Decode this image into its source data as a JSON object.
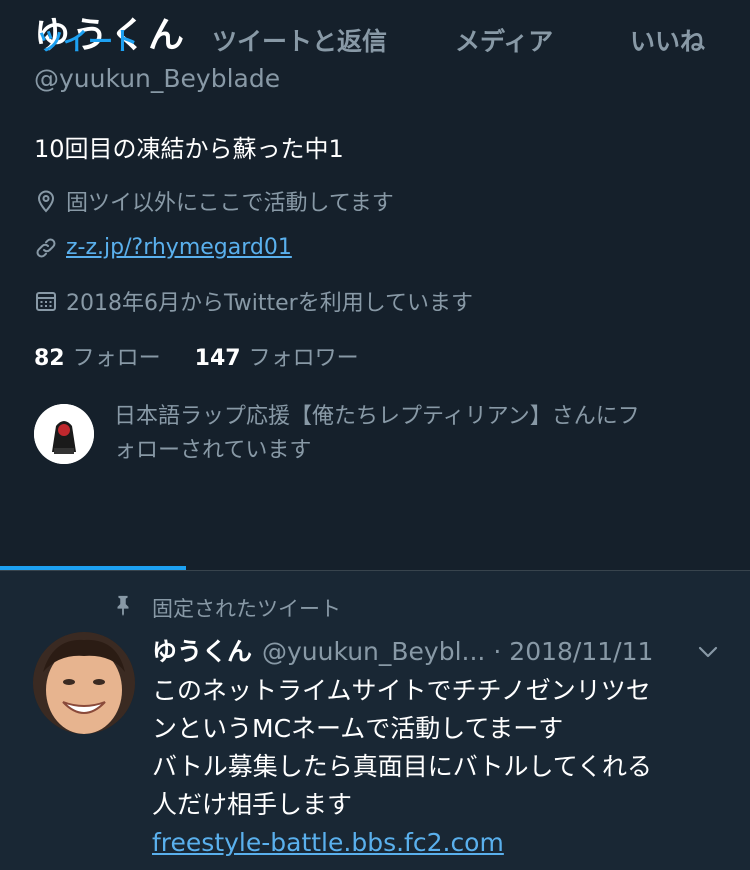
{
  "profile": {
    "name": "ゆうくん",
    "handle": "@yuukun_Beyblade",
    "bio": "10回目の凍結から蘇った中1",
    "location": "固ツイ以外にここで活動してます",
    "url": "z-z.jp/?rhymegard01",
    "joined": "2018年6月からTwitterを利用しています",
    "following_count": "82",
    "following_label": "フォロー",
    "followers_count": "147",
    "followers_label": "フォロワー",
    "followed_by_line1": "日本語ラップ応援【俺たちレプティリアン】さんにフ",
    "followed_by_line2": "ォローされています"
  },
  "tabs": [
    {
      "label": "ツイート",
      "active": true
    },
    {
      "label": "ツイートと返信",
      "active": false
    },
    {
      "label": "メディア",
      "active": false
    },
    {
      "label": "いいね",
      "active": false
    }
  ],
  "pinned_tweet": {
    "pinned_label": "固定されたツイート",
    "author_name": "ゆうくん",
    "author_handle": "@yuukun_Beybl...",
    "date": "· 2018/11/11",
    "lines": [
      "このネットライムサイトでチチノゼンリツセ",
      "ンというMCネームで活動してまーす",
      "バトル募集したら真面目にバトルしてくれる",
      "人だけ相手します"
    ],
    "link": "freestyle-battle.bbs.fc2.com"
  },
  "colors": {
    "background": "#15202b",
    "tweet_background": "#192734",
    "accent": "#1da1f2",
    "link": "#5ab0ed",
    "secondary_text": "#8899a6"
  },
  "icons": [
    "location-pin-icon",
    "link-icon",
    "calendar-icon",
    "pin-icon",
    "chevron-down-icon"
  ]
}
